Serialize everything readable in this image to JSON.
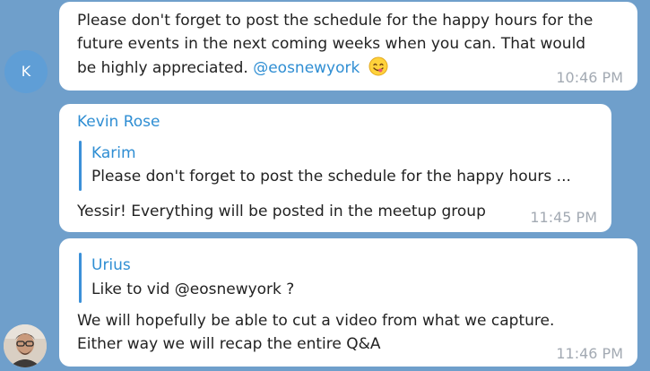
{
  "messages": [
    {
      "avatar_letter": "K",
      "lines": [
        "Please don't forget to post the schedule for the happy hours for the",
        "future events in the next coming weeks when you can. That would",
        "be highly appreciated."
      ],
      "mention": "@eosnewyork",
      "emoji_icon": "face-savoring-food-emoji",
      "time": "10:46 PM"
    },
    {
      "sender": "Kevin Rose",
      "reply": {
        "name": "Karim",
        "text": "Please don't forget to post the schedule for the happy hours ..."
      },
      "lines": [
        "Yessir! Everything will be posted in the meetup group"
      ],
      "time": "11:45 PM"
    },
    {
      "reply": {
        "name": "Urius",
        "text": "Like to vid @eosnewyork ?"
      },
      "lines": [
        "We will hopefully be able to cut a video from what we capture.",
        "Either way we will recap the entire Q&A"
      ],
      "avatar_icon": "user-photo-avatar",
      "time": "11:46 PM"
    }
  ]
}
